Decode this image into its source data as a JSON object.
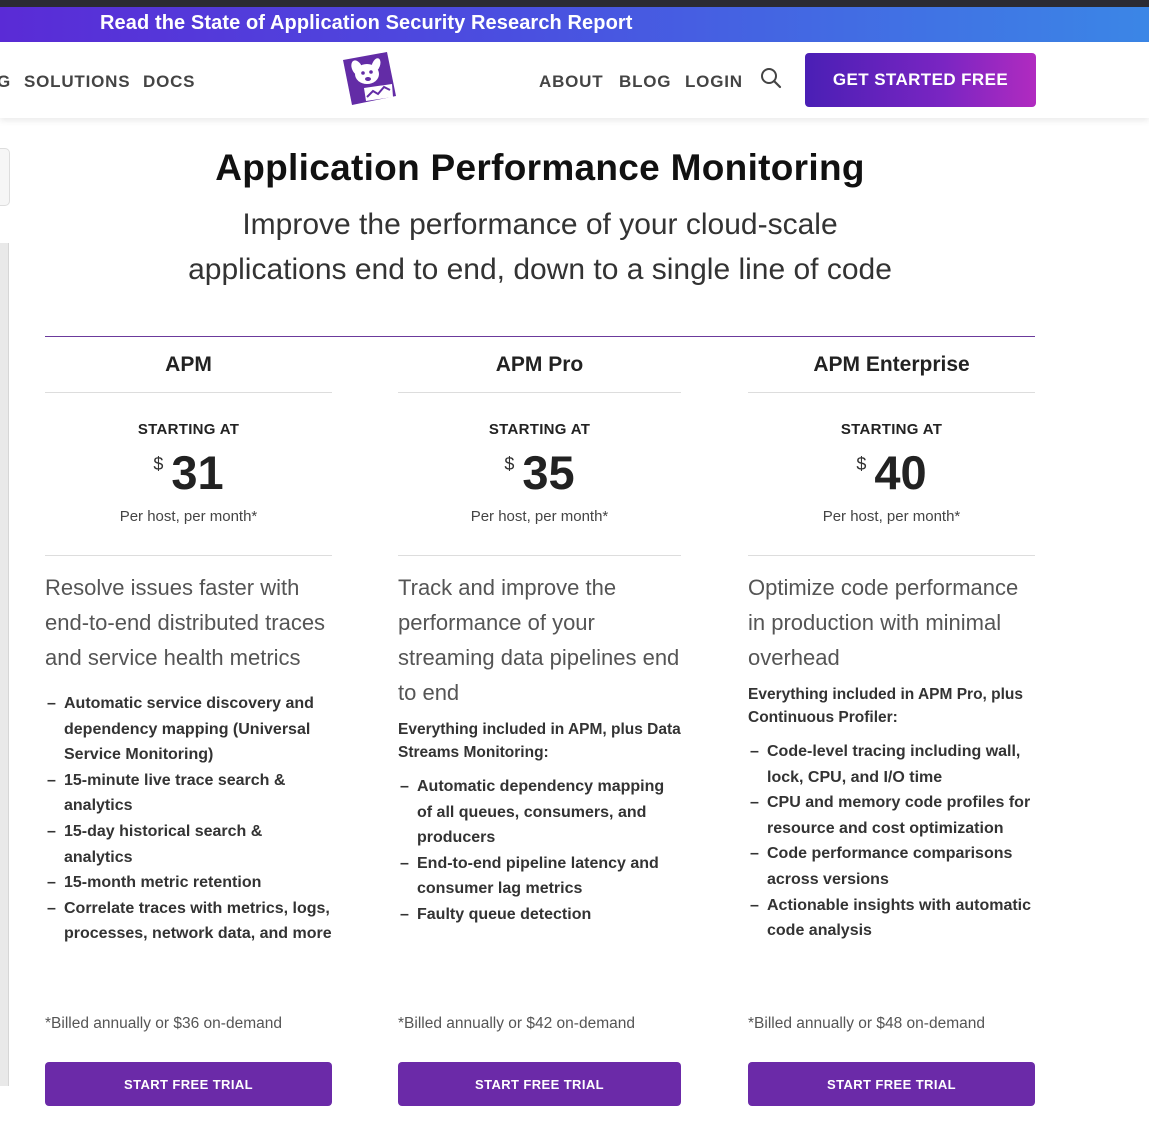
{
  "banner": {
    "text": "Read the State of Application Security Research Report"
  },
  "nav": {
    "partial_left": "G",
    "solutions": "SOLUTIONS",
    "docs": "DOCS",
    "about": "ABOUT",
    "blog": "BLOG",
    "login": "LOGIN",
    "cta": "GET STARTED FREE",
    "logo_icon": "datadog-logo-icon",
    "search_icon": "search-icon"
  },
  "hero": {
    "title": "Application Performance Monitoring",
    "subtitle_line1": "Improve the performance of your cloud-scale",
    "subtitle_line2": "applications end to end, down to a single line of code"
  },
  "colors": {
    "accent": "#6b2aa8",
    "banner_start": "#5a2bd6",
    "banner_end": "#3b86e6",
    "cta_end": "#b12bc0"
  },
  "plans": [
    {
      "name": "APM",
      "starting": "STARTING AT",
      "currency": "$",
      "price": "31",
      "per": "Per host, per month*",
      "description": "Resolve issues faster with end-to-end distributed traces and service health metrics",
      "includes": "",
      "features": [
        "Automatic service discovery and dependency mapping (Universal Service Monitoring)",
        "15-minute live trace search & analytics",
        "15-day historical search & analytics",
        "15-month metric retention",
        "Correlate traces with metrics, logs, processes, network data, and more"
      ],
      "billed": "*Billed annually or $36 on-demand",
      "button": "START FREE TRIAL"
    },
    {
      "name": "APM Pro",
      "starting": "STARTING AT",
      "currency": "$",
      "price": "35",
      "per": "Per host, per month*",
      "description": "Track and improve the performance of your streaming data pipelines end to end",
      "includes": "Everything included in APM, plus Data Streams Monitoring:",
      "features": [
        "Automatic dependency mapping of all queues, consumers, and producers",
        "End-to-end pipeline latency and consumer lag metrics",
        "Faulty queue detection"
      ],
      "billed": "*Billed annually or $42 on-demand",
      "button": "START FREE TRIAL"
    },
    {
      "name": "APM Enterprise",
      "starting": "STARTING AT",
      "currency": "$",
      "price": "40",
      "per": "Per host, per month*",
      "description": "Optimize code performance in production with minimal overhead",
      "includes": "Everything included in APM Pro, plus Continuous Profiler:",
      "features": [
        "Code-level tracing including wall, lock, CPU, and I/O time",
        "CPU and memory code profiles for resource and cost optimization",
        "Code performance comparisons across versions",
        "Actionable insights with automatic code analysis"
      ],
      "billed": "*Billed annually or $48 on-demand",
      "button": "START FREE TRIAL"
    }
  ]
}
